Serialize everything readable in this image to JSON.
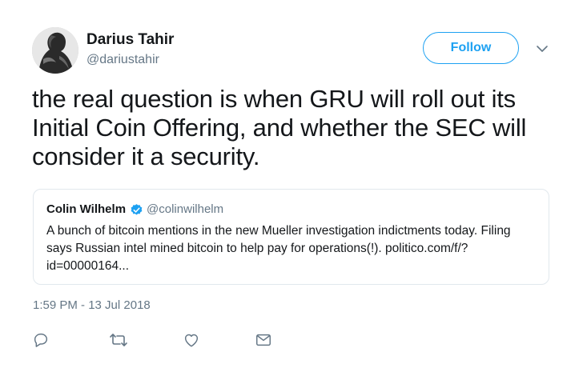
{
  "author": {
    "display_name": "Darius Tahir",
    "handle": "@dariustahir",
    "avatar_icon": "avatar-photo"
  },
  "follow_button": {
    "label": "Follow",
    "color": "#1da1f2"
  },
  "menu_caret_icon": "chevron-down-icon",
  "tweet": {
    "lines": [
      "the real question is when GRU will roll out its",
      "Initial Coin Offering, and whether the SEC will",
      "consider it a security."
    ]
  },
  "quoted_tweet": {
    "display_name": "Colin Wilhelm",
    "handle": "@colinwilhelm",
    "verified_icon": "verified-badge-icon",
    "lines": [
      "A bunch of bitcoin mentions in the new Mueller investigation indictments today. Filing",
      "says Russian intel mined bitcoin to help pay for operations(!). politico.com/f/?",
      "id=00000164..."
    ]
  },
  "timestamp": "1:59 PM - 13 Jul 2018",
  "actions": [
    "reply-icon",
    "retweet-icon",
    "like-icon",
    "message-icon"
  ],
  "colors": {
    "text": "#14171a",
    "secondary": "#657786",
    "border": "#e1e8ed",
    "accent": "#1da1f2"
  }
}
